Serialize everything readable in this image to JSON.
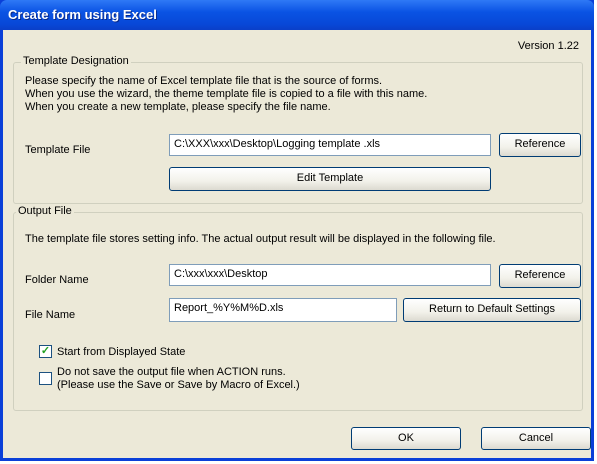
{
  "window": {
    "title": "Create form using Excel",
    "version": "Version 1.22"
  },
  "template": {
    "legend": "Template Designation",
    "desc1": "Please specify the name of Excel template file that is the source of forms.",
    "desc2": "When you use the wizard, the theme template file is copied to a file with this name.",
    "desc3": "When you create a new template, please specify the file name.",
    "file_label": "Template File",
    "file_value": "C:\\XXX\\xxx\\Desktop\\Logging template .xls",
    "reference_label": "Reference",
    "edit_label": "Edit Template"
  },
  "output": {
    "legend": "Output File",
    "desc": "The template file stores setting info. The actual output result will be displayed in the following file.",
    "folder_label": "Folder Name",
    "folder_value": "C:\\xxx\\xxx\\Desktop",
    "reference_label": "Reference",
    "filename_label": "File Name",
    "filename_value": "Report_%Y%M%D.xls",
    "default_label": "Return to Default Settings"
  },
  "options": {
    "start_label": "Start from Displayed State",
    "start_checked": true,
    "nosave_line1": "Do not save the output file when ACTION runs.",
    "nosave_line2": "(Please use the Save or Save by Macro of Excel.)",
    "nosave_checked": false
  },
  "buttons": {
    "ok": "OK",
    "cancel": "Cancel"
  }
}
